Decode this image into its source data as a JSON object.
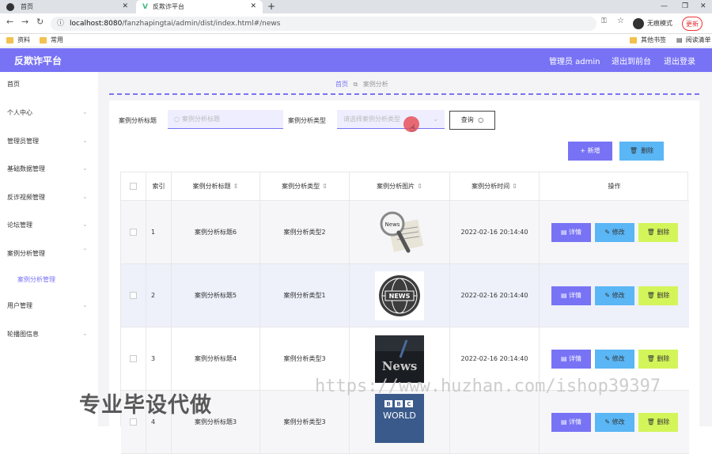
{
  "browser": {
    "tabs": [
      {
        "label": "首页"
      },
      {
        "label": "反欺诈平台"
      }
    ],
    "new_tab": "+",
    "url_host": "localhost:8080",
    "url_path": "/fanzhapingtai/admin/dist/index.html#/news",
    "incognito_label": "无痕模式",
    "update_label": "更新",
    "bookmarks": [
      {
        "label": "资料"
      },
      {
        "label": "常用"
      },
      {
        "label": "其他书签"
      },
      {
        "label": "阅读清单"
      }
    ]
  },
  "header": {
    "app_title": "反欺诈平台",
    "admin_label": "管理员 admin",
    "back_label": "退出到前台",
    "logout_label": "退出登录"
  },
  "sidebar": {
    "items": [
      {
        "label": "首页",
        "has_chevron": false
      },
      {
        "label": "个人中心",
        "has_chevron": true
      },
      {
        "label": "管理员管理",
        "has_chevron": true
      },
      {
        "label": "基础数据管理",
        "has_chevron": true
      },
      {
        "label": "反诈视频管理",
        "has_chevron": true
      },
      {
        "label": "论坛管理",
        "has_chevron": true
      },
      {
        "label": "案例分析管理",
        "has_chevron": true
      },
      {
        "label": "用户管理",
        "has_chevron": true
      },
      {
        "label": "轮播图信息",
        "has_chevron": true
      }
    ],
    "sub_item": "案例分析管理"
  },
  "breadcrumb": {
    "first": "首页",
    "second": "案例分析"
  },
  "filters": {
    "title_label": "案例分析标题",
    "title_placeholder": "案例分析标题",
    "type_label": "案例分析类型",
    "type_placeholder": "请选择案例分析类型",
    "query_label": "查询"
  },
  "actions": {
    "add_label": "+ 新增",
    "delete_label": "删除"
  },
  "table": {
    "headers": [
      "索引",
      "案例分析标题",
      "案例分析类型",
      "案例分析图片",
      "案例分析时间",
      "操作"
    ],
    "rows": [
      {
        "index": "1",
        "title": "案例分析标题6",
        "type": "案例分析类型2",
        "time": "2022-02-16 20:14:40",
        "image": "news-magnifier"
      },
      {
        "index": "2",
        "title": "案例分析标题5",
        "type": "案例分析类型1",
        "time": "2022-02-16 20:14:40",
        "image": "news-globe"
      },
      {
        "index": "3",
        "title": "案例分析标题4",
        "type": "案例分析类型3",
        "time": "2022-02-16 20:14:40",
        "image": "news-dark"
      },
      {
        "index": "4",
        "title": "案例分析标题3",
        "type": "案例分析类型3",
        "time": "",
        "image": "bbc-world"
      }
    ],
    "row_actions": {
      "detail": "详情",
      "edit": "修改",
      "delete": "删除"
    }
  },
  "watermarks": {
    "cn": "专业毕设代做",
    "url": "https://www.huzhan.com/ishop39397"
  },
  "colors": {
    "accent": "#7873f5",
    "detail": "#7873f5",
    "edit": "#5ab6f5",
    "delete": "#d4f55a"
  }
}
